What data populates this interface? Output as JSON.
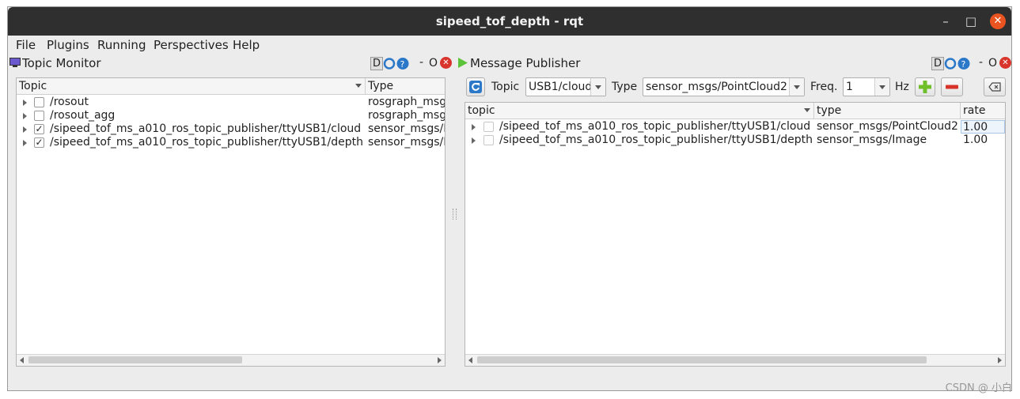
{
  "window": {
    "title": "sipeed_tof_depth - rqt",
    "minimize": "–",
    "maximize": "□",
    "close": "✕"
  },
  "menubar": [
    "File",
    "Plugins",
    "Running",
    "Perspectives",
    "Help"
  ],
  "dock_controls": {
    "d": "D",
    "help": "?",
    "minus": "-",
    "float": "O",
    "close": "✕",
    "refresh": "C"
  },
  "topic_monitor": {
    "title": "Topic Monitor",
    "columns": [
      "Topic",
      "Type"
    ],
    "rows": [
      {
        "topic": "/rosout",
        "type": "rosgraph_msg",
        "checked": false
      },
      {
        "topic": "/rosout_agg",
        "type": "rosgraph_msg",
        "checked": false
      },
      {
        "topic": "/sipeed_tof_ms_a010_ros_topic_publisher/ttyUSB1/cloud",
        "type": "sensor_msgs/F",
        "checked": true
      },
      {
        "topic": "/sipeed_tof_ms_a010_ros_topic_publisher/ttyUSB1/depth",
        "type": "sensor_msgs/I",
        "checked": true
      }
    ]
  },
  "message_publisher": {
    "title": "Message Publisher",
    "topic_label": "Topic",
    "topic_value": "USB1/cloud",
    "type_label": "Type",
    "type_value": "sensor_msgs/PointCloud2",
    "freq_label": "Freq.",
    "freq_value": "1",
    "hz_label": "Hz",
    "columns": [
      "topic",
      "type",
      "rate"
    ],
    "rows": [
      {
        "topic": "/sipeed_tof_ms_a010_ros_topic_publisher/ttyUSB1/cloud",
        "type": "sensor_msgs/PointCloud2",
        "rate": "1.00",
        "checked": false
      },
      {
        "topic": "/sipeed_tof_ms_a010_ros_topic_publisher/ttyUSB1/depth",
        "type": "sensor_msgs/Image",
        "rate": "1.00",
        "checked": false
      }
    ]
  },
  "watermark": "CSDN @ 小白",
  "icons": {
    "monitor": "monitor-icon",
    "publisher": "play-icon",
    "refresh": "refresh-icon",
    "add": "plus-icon",
    "remove": "minus-icon",
    "clear": "clear-icon"
  },
  "colors": {
    "titlebar": "#2f2f2f",
    "close": "#e95420",
    "add": "#6fbf2b",
    "remove": "#d9342b",
    "refresh": "#2b78c9"
  }
}
